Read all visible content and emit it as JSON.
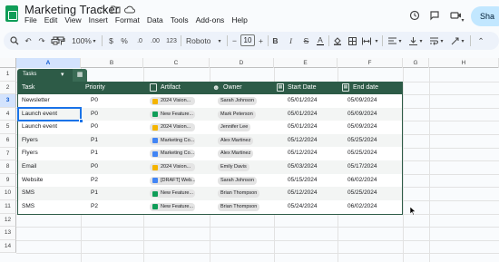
{
  "app": {
    "title": "Marketing Tracker",
    "menu": [
      "File",
      "Edit",
      "View",
      "Insert",
      "Format",
      "Data",
      "Tools",
      "Add-ons",
      "Help"
    ],
    "share_label": "Sha",
    "title_icons": [
      "star-icon",
      "folder-icon",
      "cloud-icon"
    ],
    "right_icons": [
      "history-icon",
      "comment-icon",
      "camera-icon"
    ]
  },
  "toolbar": {
    "zoom": "100%",
    "currency": "$",
    "percent": "%",
    "dec_decrease": ".0",
    "dec_increase": ".00",
    "number_format": "123",
    "font": "Roboto",
    "font_size": "10",
    "minus": "−",
    "plus": "+",
    "bold": "B",
    "italic": "I",
    "strike": "S",
    "text_color": "A"
  },
  "columns": [
    "A",
    "B",
    "C",
    "D",
    "E",
    "F",
    "G",
    "H"
  ],
  "rows": [
    "1",
    "2",
    "3",
    "4",
    "5",
    "6",
    "7",
    "8",
    "9",
    "10",
    "11",
    "12",
    "13",
    "14"
  ],
  "table": {
    "name": "Tasks",
    "headers": [
      "Task",
      "Priority",
      "Artifact",
      "Owner",
      "Start Date",
      "End date"
    ],
    "rows": [
      {
        "task": "Newsletter",
        "priority": "P0",
        "artifact": "2024 Vision...",
        "artifact_type": "slides",
        "owner": "Sarah Johnson",
        "start": "05/01/2024",
        "end": "05/09/2024"
      },
      {
        "task": "Launch event",
        "priority": "P0",
        "artifact": "New Feature...",
        "artifact_type": "sheets",
        "owner": "Mark Peterson",
        "start": "05/01/2024",
        "end": "05/09/2024"
      },
      {
        "task": "Launch event",
        "priority": "P0",
        "artifact": "2024 Vision...",
        "artifact_type": "slides",
        "owner": "Jennifer Lee",
        "start": "05/01/2024",
        "end": "05/09/2024"
      },
      {
        "task": "Flyers",
        "priority": "P1",
        "artifact": "Marketing Co...",
        "artifact_type": "docs",
        "owner": "Alex Martinez",
        "start": "05/12/2024",
        "end": "05/25/2024"
      },
      {
        "task": "Flyers",
        "priority": "P1",
        "artifact": "Marketing Co...",
        "artifact_type": "docs",
        "owner": "Alex Martinez",
        "start": "05/12/2024",
        "end": "05/25/2024"
      },
      {
        "task": "Email",
        "priority": "P0",
        "artifact": "2024 Vision...",
        "artifact_type": "slides",
        "owner": "Emily Davis",
        "start": "05/03/2024",
        "end": "05/17/2024"
      },
      {
        "task": "Website",
        "priority": "P2",
        "artifact": "[DRAFT] Web...",
        "artifact_type": "docs",
        "owner": "Sarah Johnson",
        "start": "05/15/2024",
        "end": "06/02/2024"
      },
      {
        "task": "SMS",
        "priority": "P1",
        "artifact": "New Feature...",
        "artifact_type": "sheets",
        "owner": "Brian Thompson",
        "start": "05/12/2024",
        "end": "05/25/2024"
      },
      {
        "task": "SMS",
        "priority": "P2",
        "artifact": "New Feature...",
        "artifact_type": "sheets",
        "owner": "Brian Thompson",
        "start": "05/24/2024",
        "end": "06/02/2024"
      }
    ]
  },
  "colors": {
    "table_header": "#2d5b47",
    "selection": "#1a73e8",
    "slides": "#f4b400",
    "sheets": "#0f9d58",
    "docs": "#4285f4"
  }
}
